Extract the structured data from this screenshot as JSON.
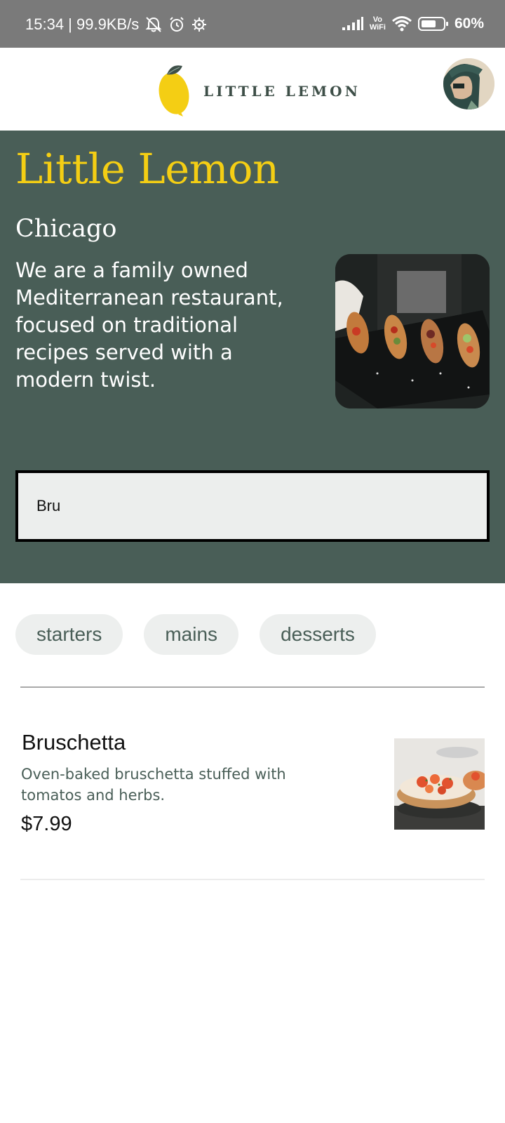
{
  "status_bar": {
    "time_speed": "15:34 | 99.9KB/s",
    "vowifi_top": "Vo",
    "vowifi_bottom": "WiFi",
    "battery": "60%"
  },
  "header": {
    "logo_text": "LITTLE LEMON"
  },
  "hero": {
    "title": "Little Lemon",
    "city": "Chicago",
    "description": "We are a family owned Mediterranean restaurant, focused on traditional recipes served with a modern twist."
  },
  "search": {
    "value": "Bru"
  },
  "categories": [
    "starters",
    "mains",
    "desserts"
  ],
  "menu": [
    {
      "name": "Bruschetta",
      "description": "Oven-baked bruschetta stuffed with tomatos and herbs.",
      "price": "$7.99"
    }
  ],
  "colors": {
    "primary_green": "#495e57",
    "primary_yellow": "#f4ce14",
    "chip_bg": "#edefee"
  }
}
